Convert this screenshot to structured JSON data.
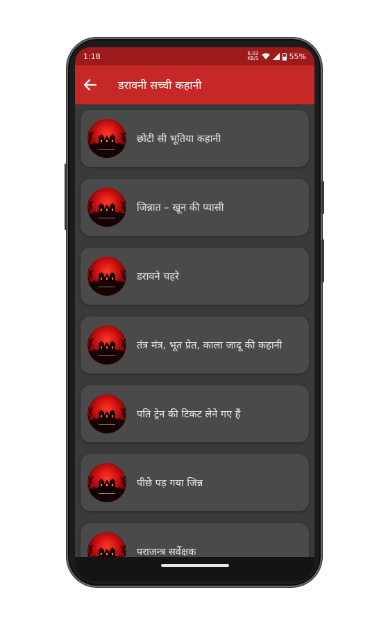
{
  "status": {
    "time": "1:18",
    "net_speed_value": "6.03",
    "net_speed_unit": "KB/S",
    "battery": "55%"
  },
  "appbar": {
    "title": "डरावनी सच्ची कहानी"
  },
  "stories": [
    {
      "title": "छोटी सी भूतिया कहानी"
    },
    {
      "title": "जिन्नात – खून की प्यासी"
    },
    {
      "title": "डरावने चहरे"
    },
    {
      "title": "तंत्र मंत्र, भूत प्रेत, काला जादू की कहानी"
    },
    {
      "title": "पति ट्रेन की टिकट लेने गए हैं"
    },
    {
      "title": "पीछे पड़ गया जिन्न"
    },
    {
      "title": "पराजन्त्र सर्वेक्षक"
    }
  ],
  "colors": {
    "statusbar": "#9e1b1b",
    "appbar": "#c62828",
    "background": "#3a3a3a",
    "card": "#4a4a4a"
  }
}
